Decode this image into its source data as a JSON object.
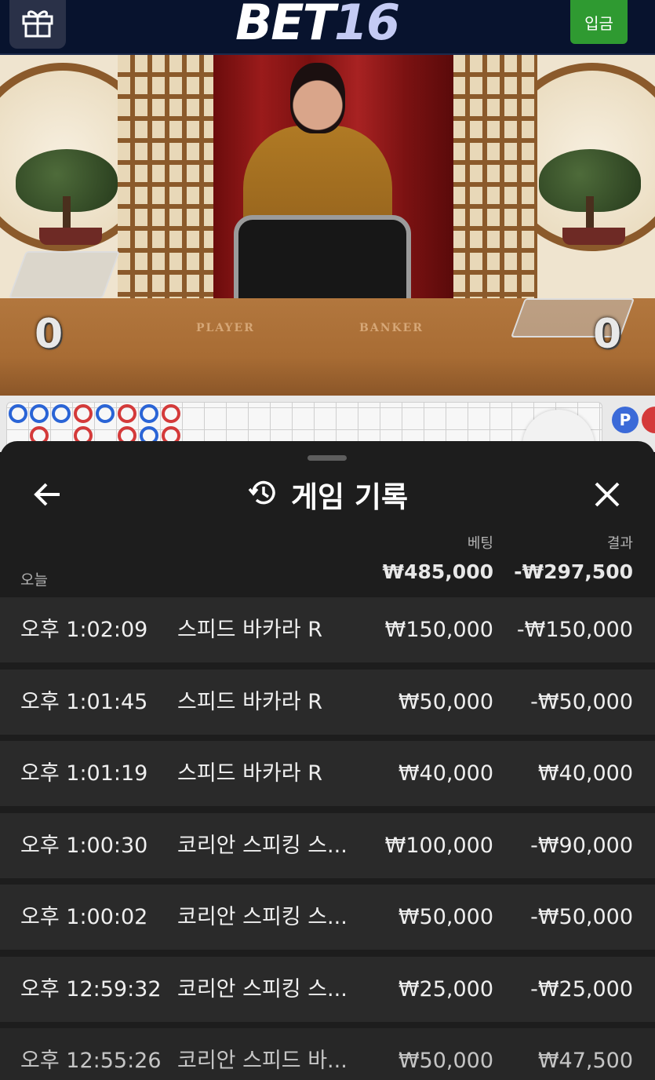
{
  "header": {
    "logo_part1": "BET",
    "logo_part2": "16",
    "deposit_label": "입금",
    "gift_icon": "gift-icon"
  },
  "scene": {
    "player_label": "PLAYER",
    "banker_label": "BANKER",
    "player_score": "0",
    "banker_score": "0"
  },
  "roads": {
    "p_badge": "P"
  },
  "history": {
    "title": "게임 기록",
    "back_icon": "arrow-left-icon",
    "history_icon": "history-icon",
    "close_icon": "close-icon",
    "columns": {
      "bet": "베팅",
      "result": "결과"
    },
    "today_label": "오늘",
    "total_bet": "₩485,000",
    "total_result": "-₩297,500",
    "rows": [
      {
        "time": "오후 1:02:09",
        "game": "스피드 바카라 R",
        "bet": "₩150,000",
        "result": "-₩150,000"
      },
      {
        "time": "오후 1:01:45",
        "game": "스피드 바카라 R",
        "bet": "₩50,000",
        "result": "-₩50,000"
      },
      {
        "time": "오후 1:01:19",
        "game": "스피드 바카라 R",
        "bet": "₩40,000",
        "result": "₩40,000"
      },
      {
        "time": "오후 1:00:30",
        "game": "코리안 스피킹 스...",
        "bet": "₩100,000",
        "result": "-₩90,000"
      },
      {
        "time": "오후 1:00:02",
        "game": "코리안 스피킹 스...",
        "bet": "₩50,000",
        "result": "-₩50,000"
      },
      {
        "time": "오후 12:59:32",
        "game": "코리안 스피킹 스...",
        "bet": "₩25,000",
        "result": "-₩25,000"
      },
      {
        "time": "오후 12:55:26",
        "game": "코리안 스피드 바...",
        "bet": "₩50,000",
        "result": "₩47,500"
      }
    ]
  }
}
